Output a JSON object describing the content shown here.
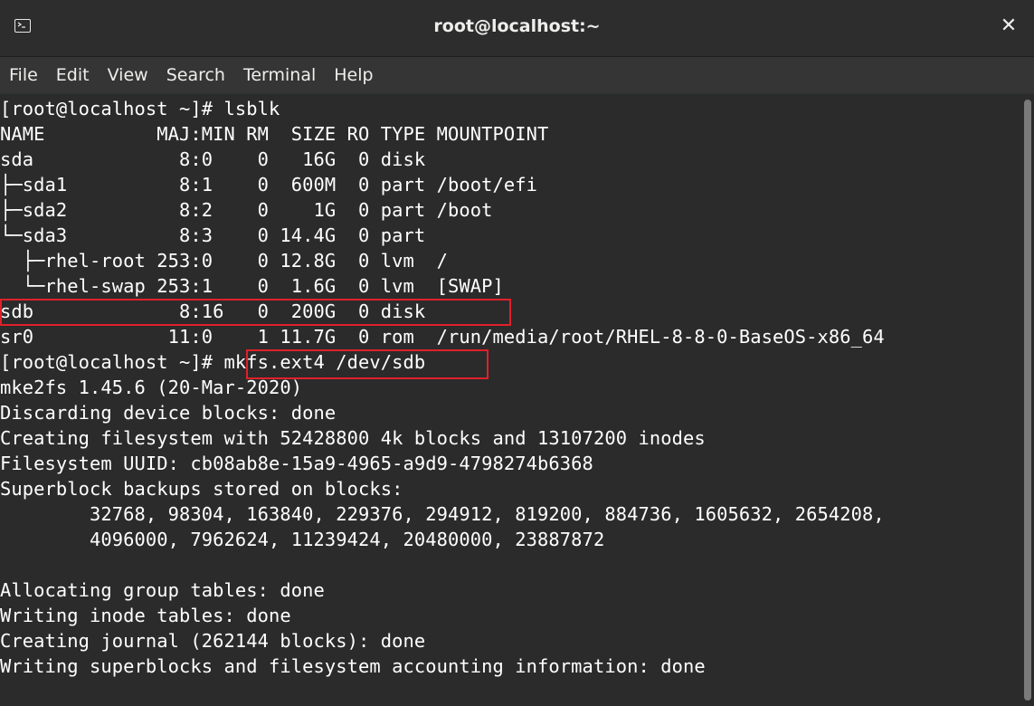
{
  "window": {
    "title": "root@localhost:~",
    "close_glyph": "✕"
  },
  "menu": [
    "File",
    "Edit",
    "View",
    "Search",
    "Terminal",
    "Help"
  ],
  "terminal_lines": [
    "[root@localhost ~]# lsblk",
    "NAME          MAJ:MIN RM  SIZE RO TYPE MOUNTPOINT",
    "sda             8:0    0   16G  0 disk",
    "├─sda1          8:1    0  600M  0 part /boot/efi",
    "├─sda2          8:2    0    1G  0 part /boot",
    "└─sda3          8:3    0 14.4G  0 part",
    "  ├─rhel-root 253:0    0 12.8G  0 lvm  /",
    "  └─rhel-swap 253:1    0  1.6G  0 lvm  [SWAP]",
    "sdb             8:16   0  200G  0 disk",
    "sr0            11:0    1 11.7G  0 rom  /run/media/root/RHEL-8-8-0-BaseOS-x86_64",
    "[root@localhost ~]# mkfs.ext4 /dev/sdb",
    "mke2fs 1.45.6 (20-Mar-2020)",
    "Discarding device blocks: done",
    "Creating filesystem with 52428800 4k blocks and 13107200 inodes",
    "Filesystem UUID: cb08ab8e-15a9-4965-a9d9-4798274b6368",
    "Superblock backups stored on blocks:",
    "        32768, 98304, 163840, 229376, 294912, 819200, 884736, 1605632, 2654208,",
    "        4096000, 7962624, 11239424, 20480000, 23887872",
    "",
    "Allocating group tables: done",
    "Writing inode tables: done",
    "Creating journal (262144 blocks): done",
    "Writing superblocks and filesystem accounting information: done"
  ],
  "colors": {
    "highlight": "#e0202a",
    "terminal_bg": "#2b2b2b",
    "text": "#ffffff"
  }
}
